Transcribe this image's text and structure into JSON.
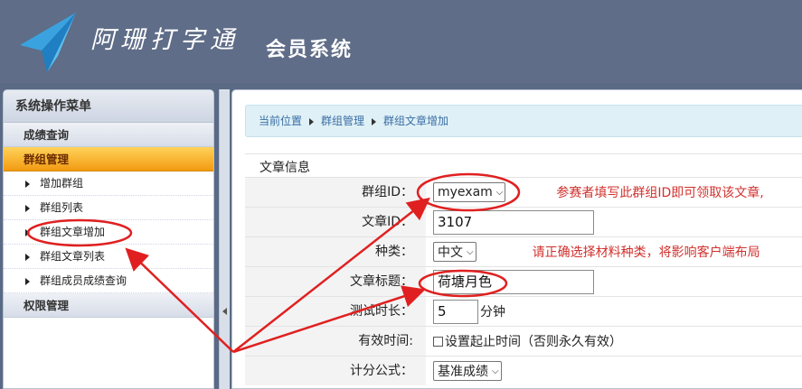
{
  "header": {
    "brand": "阿珊打字通",
    "system": "会员系统"
  },
  "sidebar": {
    "title": "系统操作菜单",
    "groups": [
      {
        "label": "成绩查询"
      },
      {
        "label": "群组管理",
        "active": true
      },
      {
        "label": "权限管理"
      }
    ],
    "items": [
      {
        "label": "增加群组"
      },
      {
        "label": "群组列表"
      },
      {
        "label": "群组文章增加"
      },
      {
        "label": "群组文章列表"
      },
      {
        "label": "群组成员成绩查询"
      }
    ]
  },
  "breadcrumb": {
    "current": "当前位置",
    "level1": "群组管理",
    "level2": "群组文章增加"
  },
  "form": {
    "section_title": "文章信息",
    "group_id": {
      "label": "群组ID：",
      "value": "myexam",
      "hint": "参赛者填写此群组ID即可领取该文章,"
    },
    "article_id": {
      "label": "文章ID：",
      "value": "3107"
    },
    "category": {
      "label": "种类：",
      "value": "中文",
      "hint": "请正确选择材料种类，将影响客户端布局"
    },
    "title": {
      "label": "文章标题：",
      "value": "荷塘月色"
    },
    "duration": {
      "label": "测试时长：",
      "value": "5",
      "unit": "分钟"
    },
    "valid_time": {
      "label": "有效时间:",
      "checkbox_label": "设置起止时间（否则永久有效）"
    },
    "scoring": {
      "label": "计分公式：",
      "value": "基准成绩"
    }
  },
  "colors": {
    "header_bg": "#5f6d88",
    "active_group": "#f29b12",
    "annotation_red": "#e02020",
    "hint_red": "#d0312d"
  }
}
